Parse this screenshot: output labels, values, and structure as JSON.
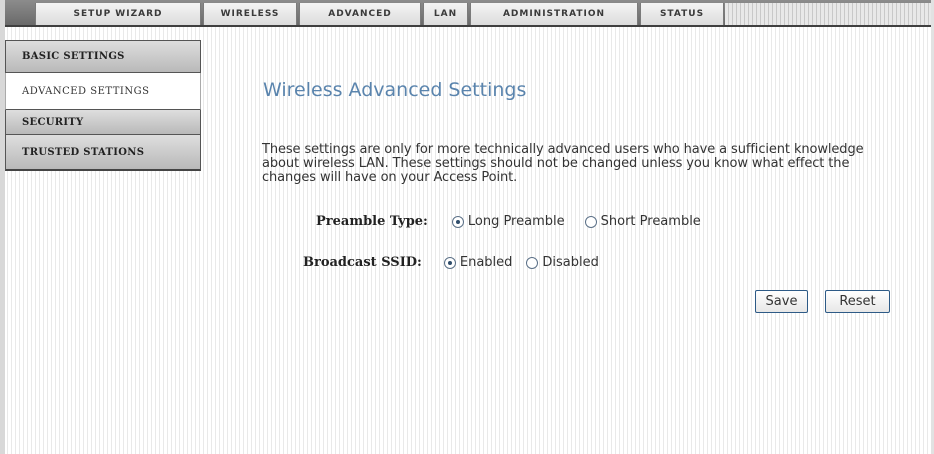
{
  "topnav": {
    "tabs": [
      {
        "label": "SETUP WIZARD"
      },
      {
        "label": "WIRELESS"
      },
      {
        "label": "ADVANCED"
      },
      {
        "label": "LAN"
      },
      {
        "label": "ADMINISTRATION"
      },
      {
        "label": "STATUS"
      }
    ]
  },
  "sidebar": {
    "items": [
      {
        "label": "BASIC SETTINGS"
      },
      {
        "label": "ADVANCED SETTINGS",
        "active": true
      },
      {
        "label": "SECURITY"
      },
      {
        "label": "TRUSTED STATIONS"
      }
    ]
  },
  "main": {
    "title": "Wireless Advanced Settings",
    "description": "These settings are only for more technically advanced users who have a sufficient knowledge about wireless LAN. These settings should not be changed unless you know what effect the changes will have on your Access Point.",
    "preamble": {
      "label": "Preamble Type:",
      "options": [
        "Long Preamble",
        "Short Preamble"
      ],
      "selected": "Long Preamble"
    },
    "broadcast": {
      "label": "Broadcast SSID:",
      "options": [
        "Enabled",
        "Disabled"
      ],
      "selected": "Enabled"
    },
    "buttons": {
      "save": "Save",
      "reset": "Reset"
    }
  },
  "colors": {
    "title": "#5a84ad",
    "button_border": "#2d5a86",
    "nav_bar": "#7a7a7a"
  }
}
